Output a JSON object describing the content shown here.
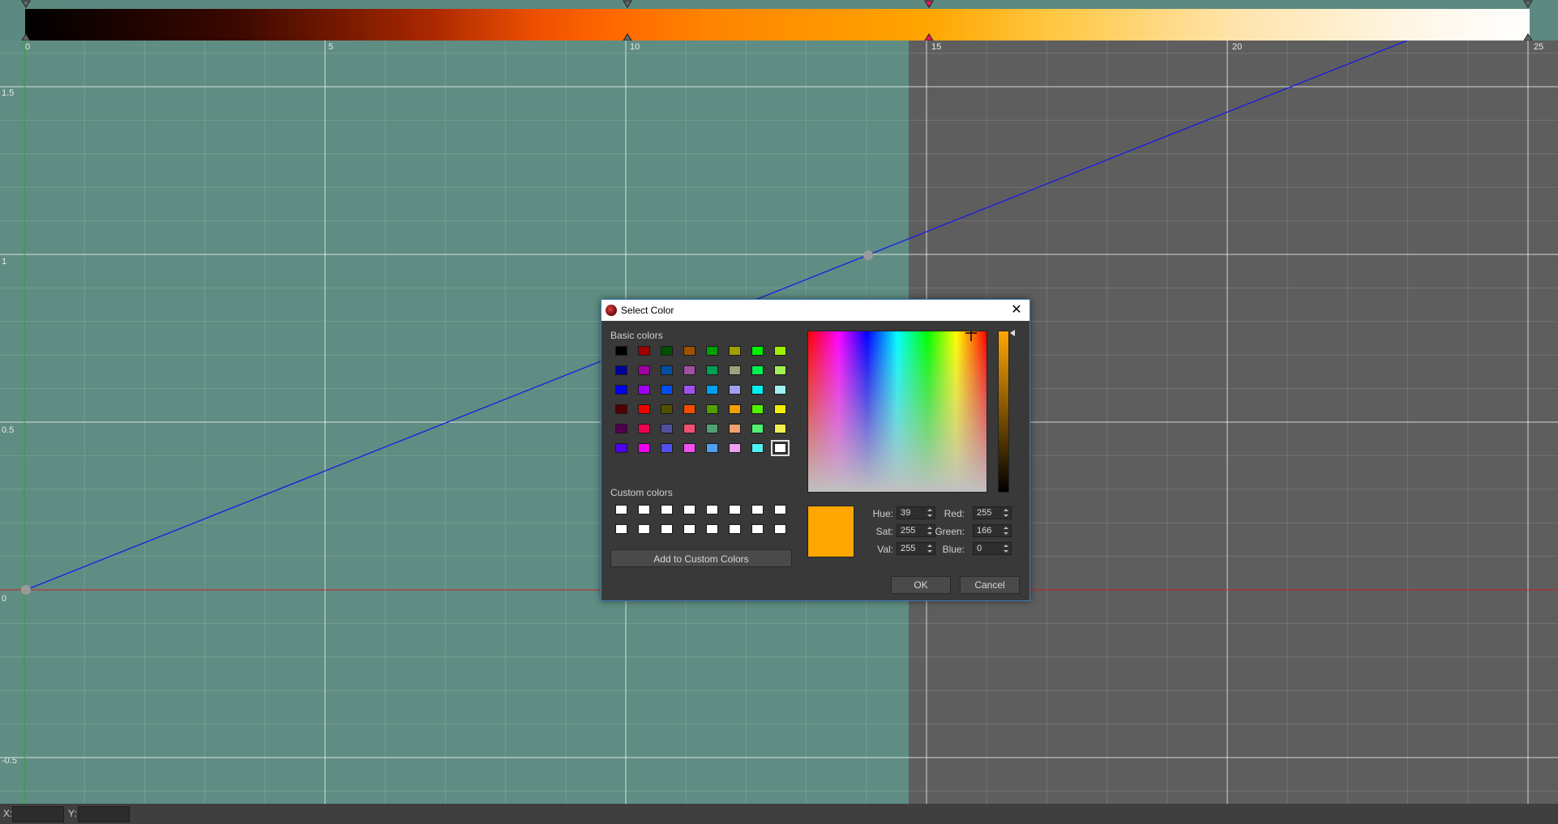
{
  "gradient_editor": {
    "colors": {
      "panel_bg": "#5c8a80",
      "selected_stop": "#e81a5c",
      "stop": "#555555"
    }
  },
  "curve_editor": {
    "x_ticks": [
      "0",
      "5",
      "10",
      "15",
      "20",
      "25"
    ],
    "y_ticks": [
      "1.5",
      "1",
      "0.5",
      "0",
      "-0.5"
    ],
    "colors": {
      "highlight_region": "#5f8d83",
      "background": "#5e5e5e",
      "curve": "#1a1ae6",
      "x_axis": "#cc2222",
      "y_axis": "#22aa22"
    }
  },
  "status_bar": {
    "x_label": "X:",
    "y_label": "Y:"
  },
  "dialog": {
    "title": "Select Color",
    "icon": "app-icon",
    "close_icon": "close-icon",
    "basic_colors_label": "Basic colors",
    "basic_colors": [
      "#000000",
      "#a00000",
      "#005000",
      "#a05000",
      "#00a000",
      "#a0a000",
      "#00f000",
      "#a0f000",
      "#0000a0",
      "#a000a0",
      "#0050a0",
      "#a050a0",
      "#00a050",
      "#a0a080",
      "#00f050",
      "#a0f050",
      "#0000f0",
      "#a000f0",
      "#0050f0",
      "#a050f0",
      "#00a0f0",
      "#a0a0f0",
      "#00f0f0",
      "#a0f0f0",
      "#500000",
      "#f00000",
      "#505000",
      "#f05000",
      "#50a000",
      "#f0a000",
      "#50f000",
      "#f0f000",
      "#500050",
      "#f00050",
      "#5050a0",
      "#f05070",
      "#50a070",
      "#f0a070",
      "#50f070",
      "#f0f050",
      "#5000f0",
      "#f000f0",
      "#5050f0",
      "#f050f0",
      "#50a0f0",
      "#f0a0f0",
      "#50f0f0",
      "#ffffff"
    ],
    "custom_colors_label": "Custom colors",
    "add_custom_label": "Add to Custom Colors",
    "hue_label": "Hue:",
    "hue_value": "39",
    "sat_label": "Sat:",
    "sat_value": "255",
    "val_label": "Val:",
    "val_value": "255",
    "red_label": "Red:",
    "red_value": "255",
    "green_label": "Green:",
    "green_value": "166",
    "blue_label": "Blue:",
    "blue_value": "0",
    "current_color": "#ffa600",
    "ok_label": "OK",
    "cancel_label": "Cancel"
  }
}
